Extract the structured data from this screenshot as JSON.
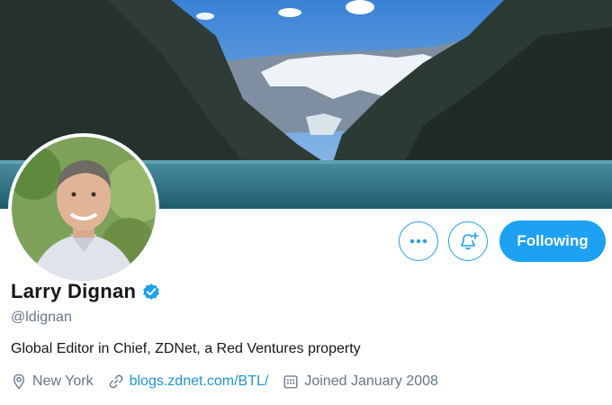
{
  "profile": {
    "name": "Larry Dignan",
    "handle": "@ldignan",
    "bio": "Global Editor in Chief, ZDNet, a Red Ventures property",
    "location": "New York",
    "website": "blogs.zdnet.com/BTL/",
    "joined": "Joined January 2008",
    "verified": true
  },
  "actions": {
    "more_icon": "more-dots-icon",
    "notify_icon": "bell-plus-icon",
    "follow_label": "Following"
  },
  "icons": {
    "location": "location-pin-icon",
    "website": "link-icon",
    "joined": "calendar-icon",
    "verified": "verified-badge-icon"
  },
  "colors": {
    "accent": "#1da1f2",
    "link": "#1b95e0",
    "secondary_text": "#657786",
    "primary_text": "#14171a"
  }
}
